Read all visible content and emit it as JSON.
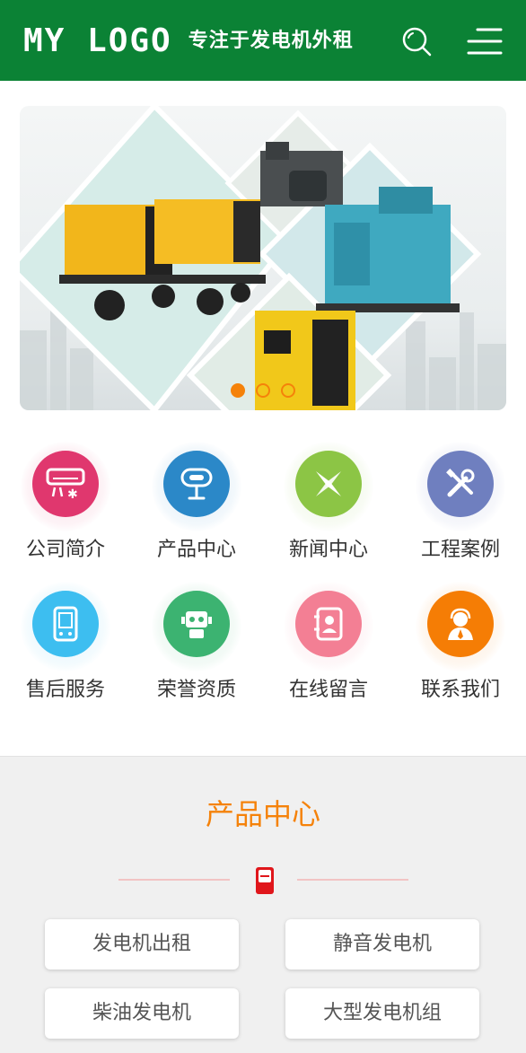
{
  "header": {
    "logo_text": "MY LOGO",
    "slogan": "专注于发电机外租",
    "search_icon": "search-icon",
    "menu_icon": "menu-icon",
    "background_color": "#0b8235"
  },
  "banner": {
    "slide_count": 3,
    "active_slide": 1,
    "accent_color": "#f5820a"
  },
  "nav": {
    "items": [
      {
        "label": "公司简介",
        "icon": "air-conditioner-icon",
        "color": "#e0376e"
      },
      {
        "label": "产品中心",
        "icon": "signpost-icon",
        "color": "#2b88c8"
      },
      {
        "label": "新闻中心",
        "icon": "pinwheel-icon",
        "color": "#8cc545"
      },
      {
        "label": "工程案例",
        "icon": "tools-icon",
        "color": "#6f7fbf"
      },
      {
        "label": "售后服务",
        "icon": "phone-icon",
        "color": "#3dbef0"
      },
      {
        "label": "荣誉资质",
        "icon": "robot-icon",
        "color": "#3cb371"
      },
      {
        "label": "在线留言",
        "icon": "contact-card-icon",
        "color": "#f37f94"
      },
      {
        "label": "联系我们",
        "icon": "customer-service-icon",
        "color": "#f57d05"
      }
    ]
  },
  "products": {
    "title": "产品中心",
    "title_color": "#f5820a",
    "categories": [
      "发电机出租",
      "静音发电机",
      "柴油发电机",
      "大型发电机组"
    ]
  }
}
